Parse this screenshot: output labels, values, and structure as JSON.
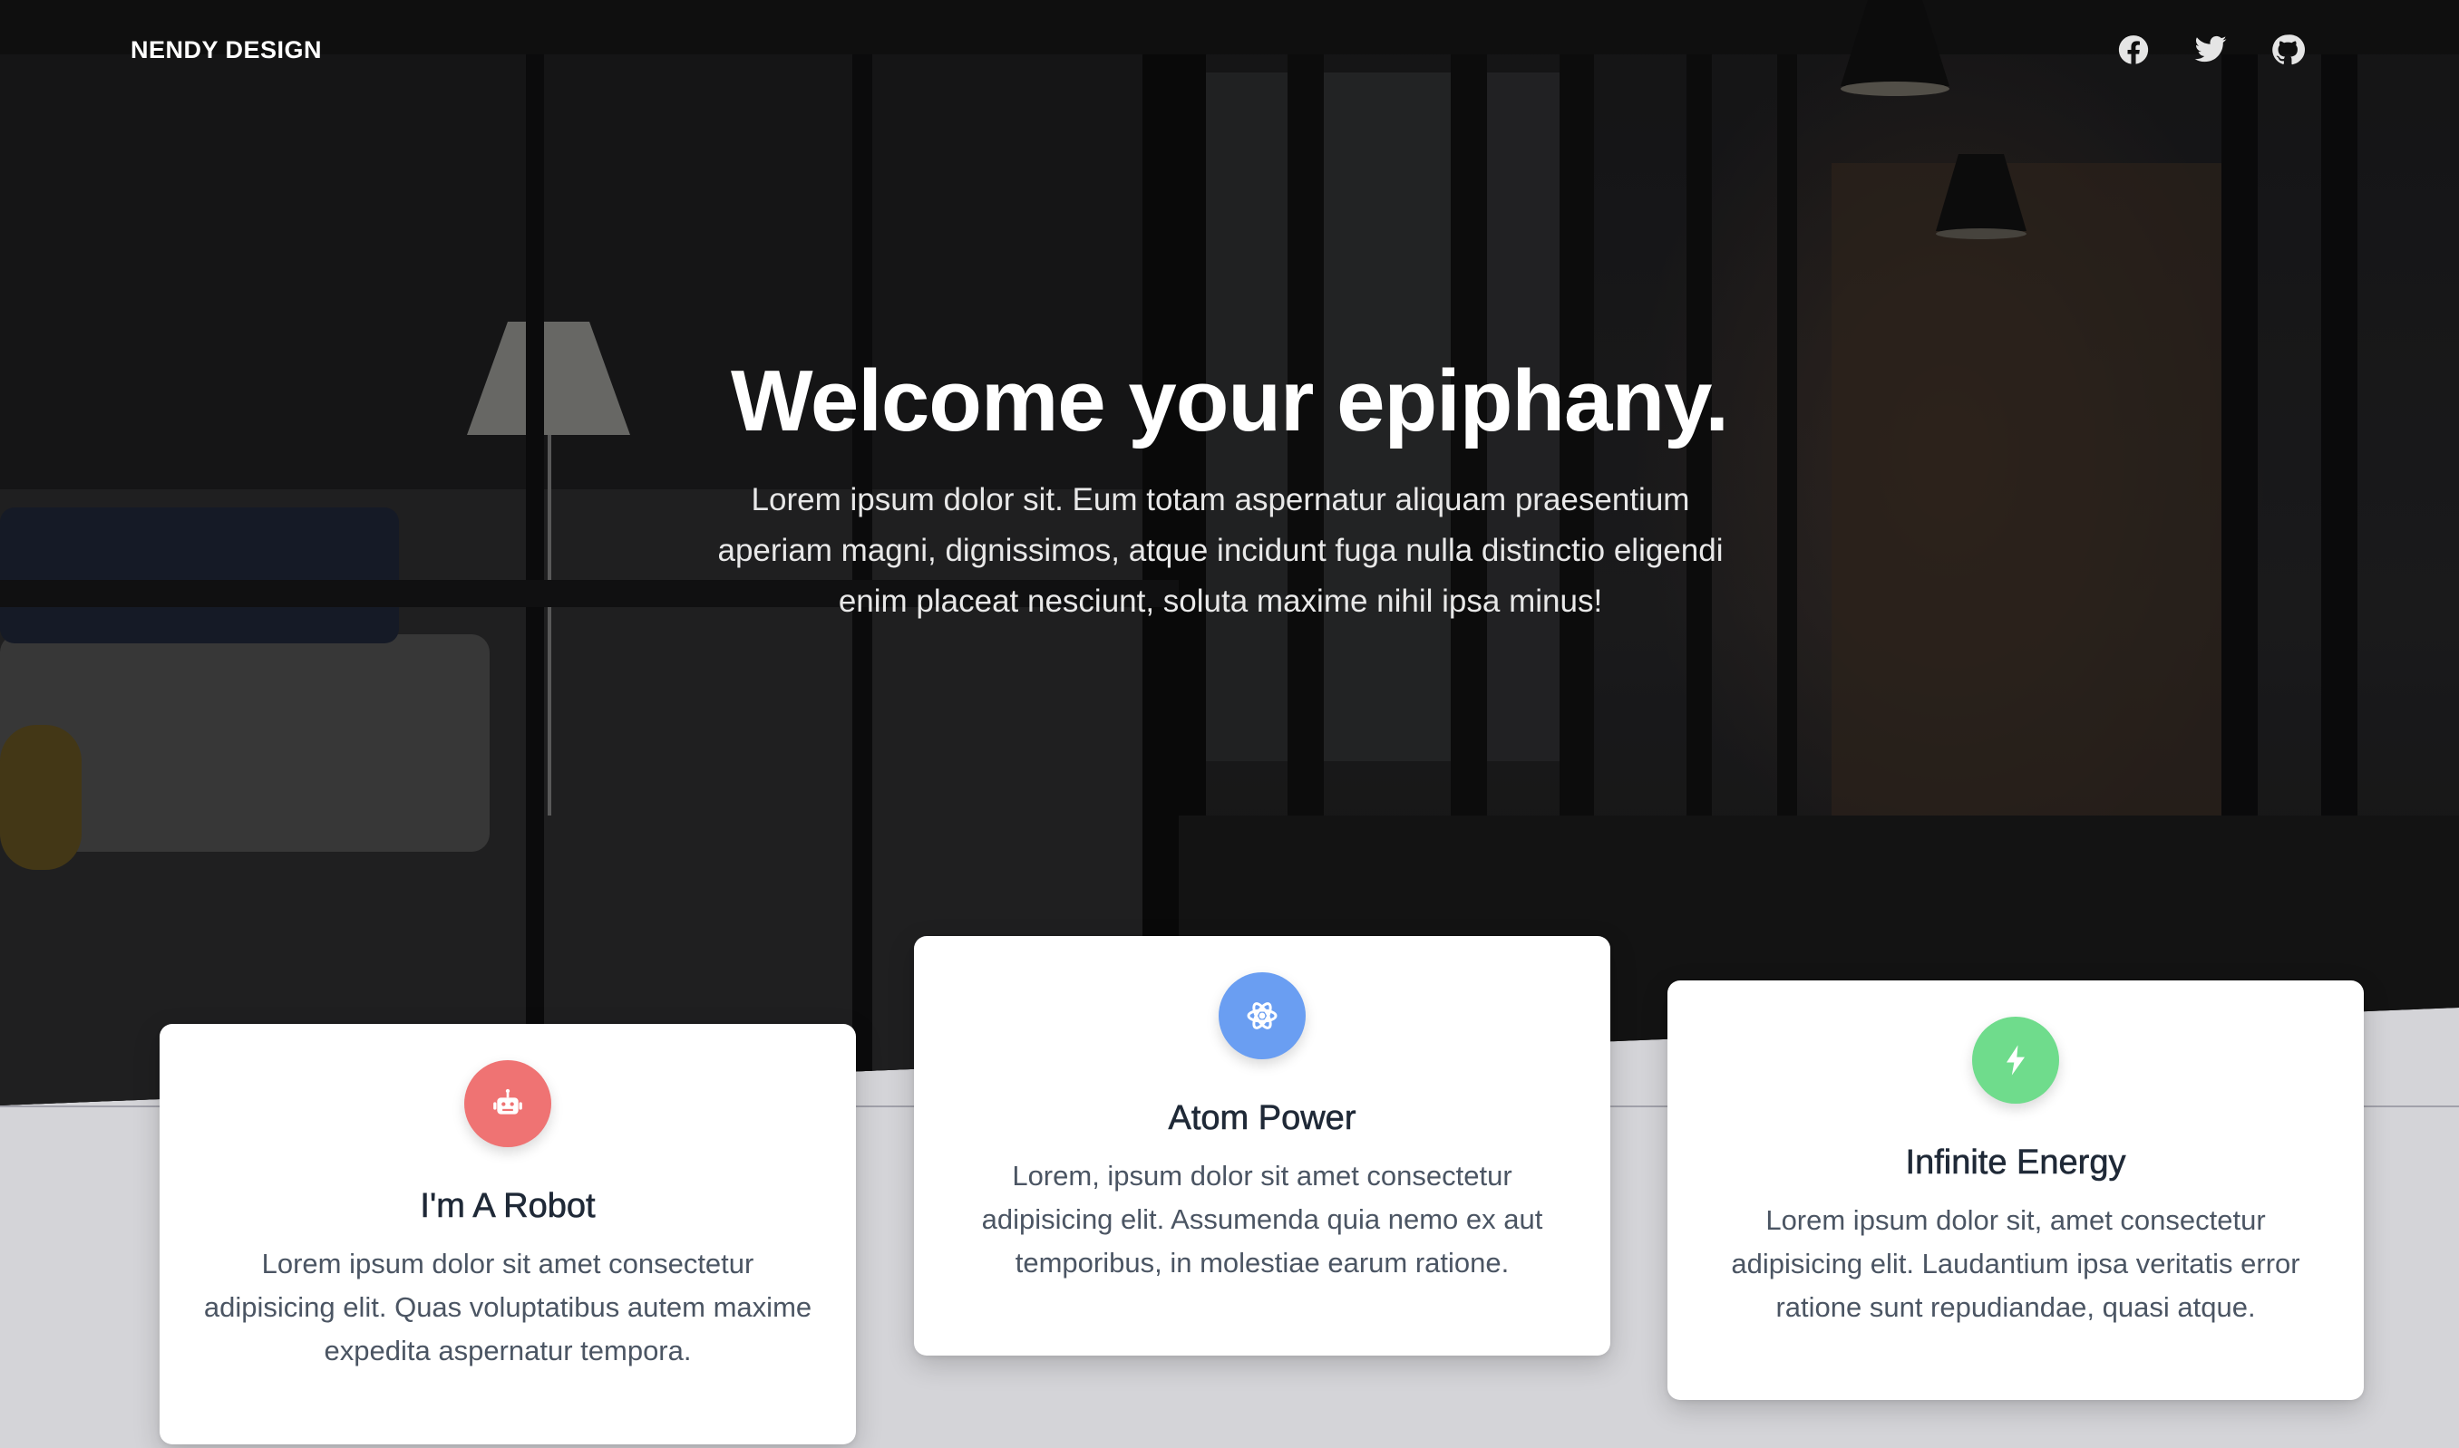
{
  "nav": {
    "brand": "NENDY DESIGN",
    "social": [
      {
        "icon": "facebook-icon"
      },
      {
        "icon": "twitter-icon"
      },
      {
        "icon": "github-icon"
      }
    ]
  },
  "hero": {
    "title": "Welcome your epiphany.",
    "subtitle": "Lorem ipsum dolor sit. Eum totam aspernatur aliquam praesentium aperiam magni, dignissimos, atque incidunt fuga nulla distinctio eligendi enim placeat nesciunt, soluta maxime nihil ipsa minus!"
  },
  "cards": [
    {
      "icon": "robot-icon",
      "color": "#ef7373",
      "title": "I'm A Robot",
      "text": "Lorem ipsum dolor sit amet consectetur adipisicing elit. Quas voluptatibus autem maxime expedita aspernatur tempora."
    },
    {
      "icon": "atom-icon",
      "color": "#6a9ef2",
      "title": "Atom Power",
      "text": "Lorem, ipsum dolor sit amet consectetur adipisicing elit. Assumenda quia nemo ex aut temporibus, in molestiae earum ratione."
    },
    {
      "icon": "bolt-icon",
      "color": "#6fdc8c",
      "title": "Infinite Energy",
      "text": "Lorem ipsum dolor sit, amet consectetur adipisicing elit. Laudantium ipsa veritatis error ratione sunt repudiandae, quasi atque."
    }
  ]
}
